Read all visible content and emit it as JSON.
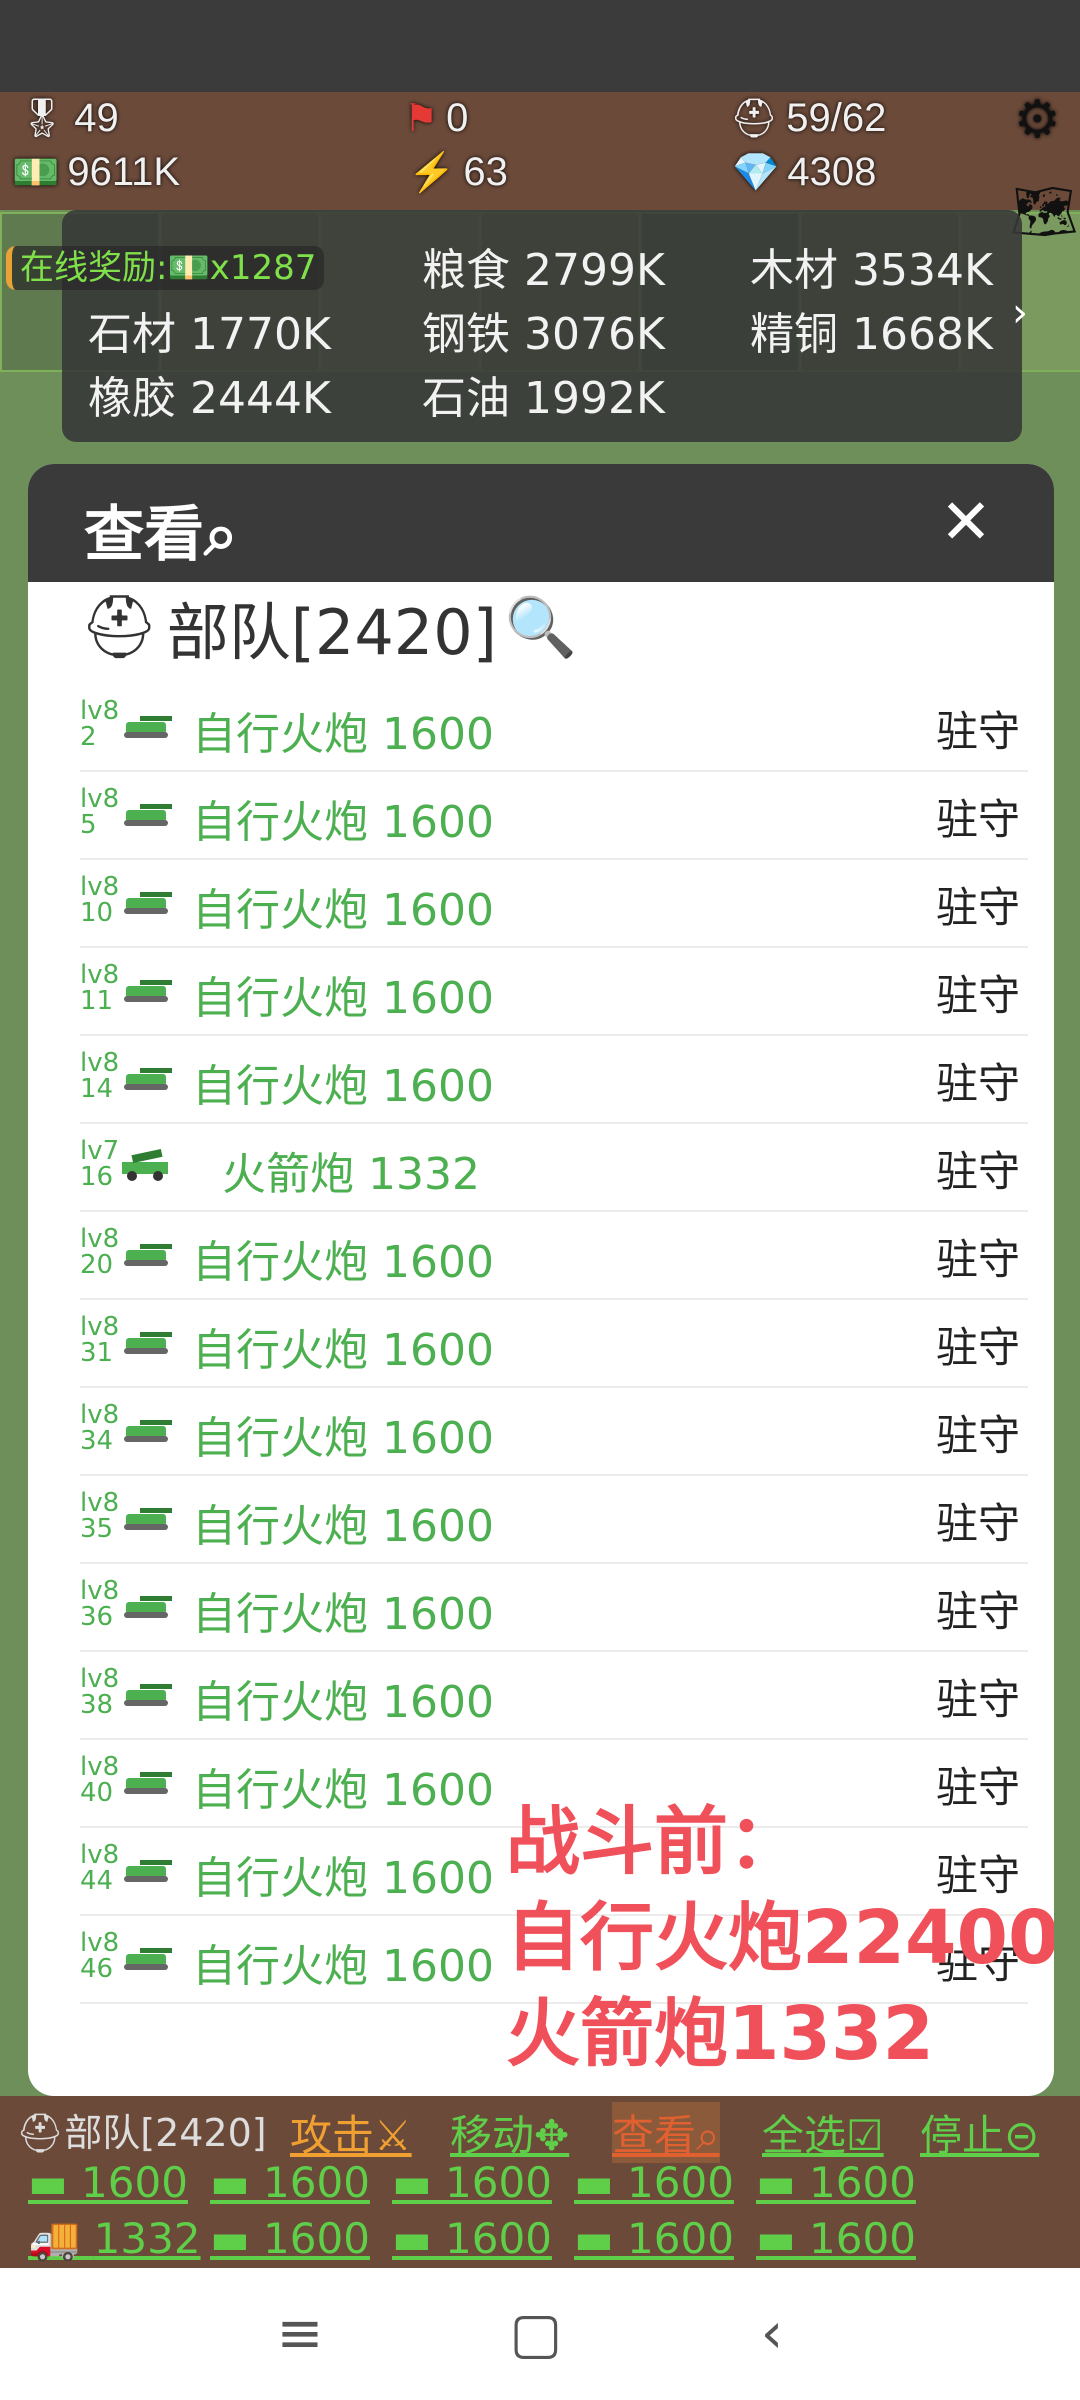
{
  "top_stats": {
    "medal": "49",
    "flag": "0",
    "troops": "59/62",
    "cash": "9611K",
    "energy": "63",
    "diamond": "4308"
  },
  "online_reward": "在线奖励:💵x1287",
  "resources": [
    {
      "label": "粮食 2799K"
    },
    {
      "label": "木材 3534K"
    },
    {
      "label": "石材 1770K"
    },
    {
      "label": "钢铁 3076K"
    },
    {
      "label": "精铜 1668K"
    },
    {
      "label": "橡胶 2444K"
    },
    {
      "label": "石油 1992K"
    }
  ],
  "modal": {
    "title": "查看⌕",
    "close": "✕",
    "troop_header": "部队[2420]",
    "units": [
      {
        "lv": "lv8",
        "num": "2",
        "name": "自行火炮 1600",
        "status": "驻守",
        "type": "tank"
      },
      {
        "lv": "lv8",
        "num": "5",
        "name": "自行火炮 1600",
        "status": "驻守",
        "type": "tank"
      },
      {
        "lv": "lv8",
        "num": "10",
        "name": "自行火炮 1600",
        "status": "驻守",
        "type": "tank"
      },
      {
        "lv": "lv8",
        "num": "11",
        "name": "自行火炮 1600",
        "status": "驻守",
        "type": "tank"
      },
      {
        "lv": "lv8",
        "num": "14",
        "name": "自行火炮 1600",
        "status": "驻守",
        "type": "tank"
      },
      {
        "lv": "lv7",
        "num": "16",
        "name": "火箭炮 1332",
        "status": "驻守",
        "type": "rocket"
      },
      {
        "lv": "lv8",
        "num": "20",
        "name": "自行火炮 1600",
        "status": "驻守",
        "type": "tank"
      },
      {
        "lv": "lv8",
        "num": "31",
        "name": "自行火炮 1600",
        "status": "驻守",
        "type": "tank"
      },
      {
        "lv": "lv8",
        "num": "34",
        "name": "自行火炮 1600",
        "status": "驻守",
        "type": "tank"
      },
      {
        "lv": "lv8",
        "num": "35",
        "name": "自行火炮 1600",
        "status": "驻守",
        "type": "tank"
      },
      {
        "lv": "lv8",
        "num": "36",
        "name": "自行火炮 1600",
        "status": "驻守",
        "type": "tank"
      },
      {
        "lv": "lv8",
        "num": "38",
        "name": "自行火炮 1600",
        "status": "驻守",
        "type": "tank"
      },
      {
        "lv": "lv8",
        "num": "40",
        "name": "自行火炮 1600",
        "status": "驻守",
        "type": "tank"
      },
      {
        "lv": "lv8",
        "num": "44",
        "name": "自行火炮 1600",
        "status": "驻守",
        "type": "tank"
      },
      {
        "lv": "lv8",
        "num": "46",
        "name": "自行火炮 1600",
        "status": "驻守",
        "type": "tank"
      }
    ]
  },
  "annotation": {
    "line1": "战斗前：",
    "line2": "自行火炮22400",
    "line3": "火箭炮1332"
  },
  "command_bar": {
    "troop_label": "部队[2420]",
    "attack": "攻击⚔",
    "move": "移动✥",
    "view": "查看⌕",
    "select_all": "全选☑",
    "stop": "停止⊝",
    "chips_row1": [
      "1600",
      "1600",
      "1600",
      "1600",
      "1600"
    ],
    "chips_row2": [
      "1332",
      "1600",
      "1600",
      "1600",
      "1600"
    ]
  },
  "colors": {
    "accent_green": "#4caf50",
    "annotation_red": "#f0505a",
    "modal_header": "#3a3a3a",
    "game_brown": "#6b4a3a"
  }
}
